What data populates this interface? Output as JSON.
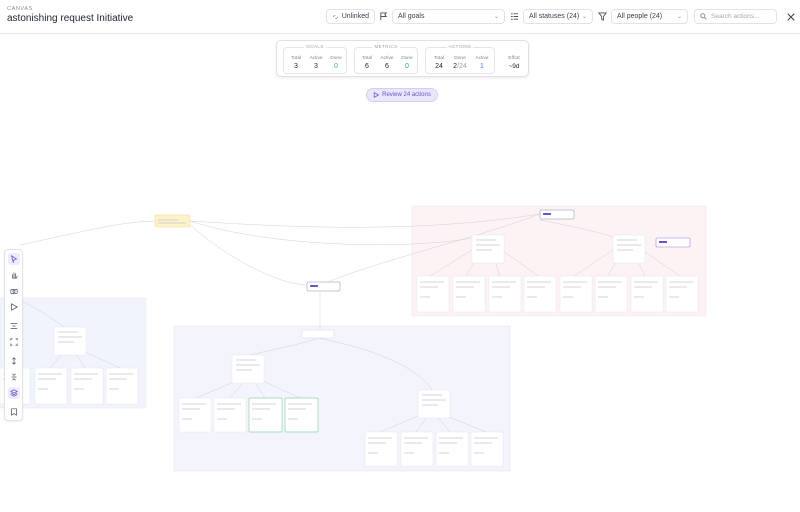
{
  "header": {
    "eyebrow": "CANVAS",
    "title": "astonishing request Initiative",
    "unlinked_label": "Unlinked",
    "goals_value": "All goals",
    "statuses_value": "All statuses (24)",
    "people_value": "All people (24)",
    "search_placeholder": "Search actions..."
  },
  "stats": {
    "goals": {
      "title": "GOALS",
      "total_label": "Total",
      "total": "3",
      "active_label": "Active",
      "active": "3",
      "done_label": "Done",
      "done": "0"
    },
    "metrics": {
      "title": "METRICS",
      "total_label": "Total",
      "total": "6",
      "active_label": "Active",
      "active": "6",
      "done_label": "Done",
      "done": "0"
    },
    "actions": {
      "title": "ACTIONS",
      "total_label": "Total",
      "total": "24",
      "done_label": "Done",
      "done": "2",
      "done_of": "/24",
      "active_label": "Active",
      "active": "1"
    },
    "effort_label": "Effort",
    "effort_value": "~9d"
  },
  "review_label": "Review 24 actions",
  "colors": {
    "accent": "#6b52c9",
    "done_green": "#2bb673",
    "active_blue": "#4e7cf0",
    "region_pink": "#fdf2f4",
    "region_blue": "#f2f4fd",
    "root_node": "#fdf1c9"
  },
  "toolbar": {
    "tools": [
      "cursor-icon",
      "hand-icon",
      "camera-icon",
      "play-icon",
      "align-icon",
      "frame-icon",
      "expand-icon",
      "collapse-icon",
      "layers-icon",
      "bookmark-icon"
    ]
  }
}
